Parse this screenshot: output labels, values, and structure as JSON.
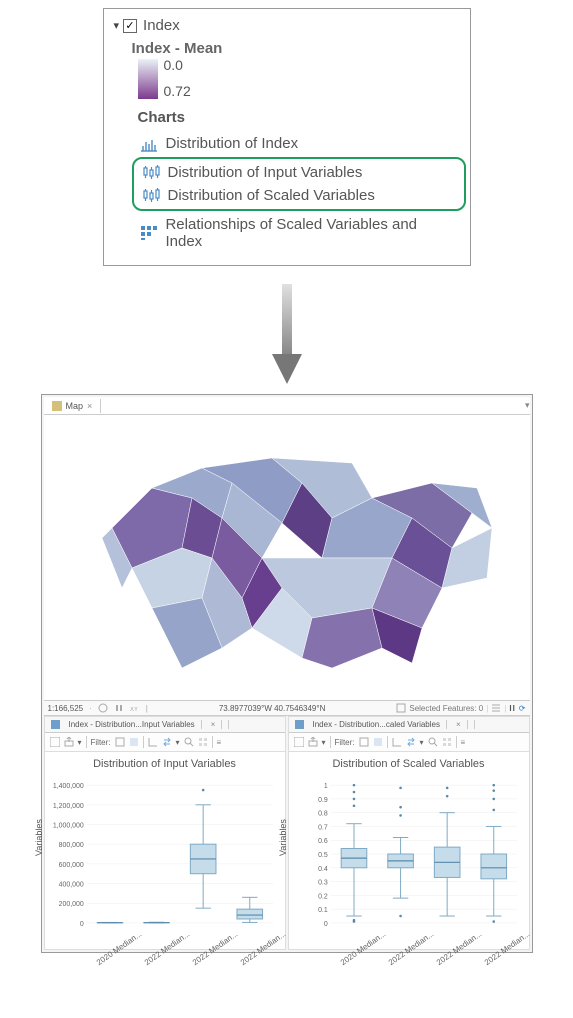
{
  "layer": {
    "name": "Index",
    "checked": true,
    "legend_title": "Index - Mean",
    "legend_min": "0.0",
    "legend_max": "0.72",
    "charts_header": "Charts",
    "chart_items": [
      {
        "label": "Distribution of Index",
        "icon": "histogram"
      },
      {
        "label": "Distribution of Input Variables",
        "icon": "boxplot"
      },
      {
        "label": "Distribution of Scaled Variables",
        "icon": "boxplot"
      },
      {
        "label": "Relationships of Scaled Variables and Index",
        "icon": "matrix"
      }
    ]
  },
  "map": {
    "tab_label": "Map",
    "scale": "1:166,525",
    "coords": "73.8977039°W 40.7546349°N",
    "selected_label": "Selected Features: 0",
    "colors": {
      "low": "#d6e4ef",
      "mid": "#8fa3c9",
      "high": "#762a83"
    }
  },
  "filter_label": "Filter:",
  "charts": {
    "left": {
      "tab": "Index - Distribution...Input Variables",
      "title": "Distribution of Input Variables",
      "y_label": "Variables"
    },
    "right": {
      "tab": "Index - Distribution...caled Variables",
      "title": "Distribution of Scaled Variables",
      "y_label": "Variables"
    }
  },
  "chart_data": [
    {
      "type": "boxplot",
      "title": "Distribution of Input Variables",
      "ylabel": "Variables",
      "ylim": [
        0,
        1400000
      ],
      "yticks": [
        0,
        200000,
        400000,
        600000,
        800000,
        1000000,
        1200000,
        1400000
      ],
      "ytick_labels": [
        "0",
        "200,000",
        "400,000",
        "600,000",
        "800,000",
        "1,000,000",
        "1,200,000",
        "1,400,000"
      ],
      "categories": [
        "2020 Median...",
        "2022 Median...",
        "2022 Median...",
        "2022 Median..."
      ],
      "series": [
        {
          "min": 0,
          "q1": 1000,
          "median": 2000,
          "q3": 3000,
          "max": 5000,
          "outliers": []
        },
        {
          "min": 0,
          "q1": 1500,
          "median": 2500,
          "q3": 4000,
          "max": 7000,
          "outliers": []
        },
        {
          "min": 150000,
          "q1": 500000,
          "median": 650000,
          "q3": 800000,
          "max": 1200000,
          "outliers": [
            1350000
          ]
        },
        {
          "min": 5000,
          "q1": 40000,
          "median": 80000,
          "q3": 140000,
          "max": 260000,
          "outliers": []
        }
      ]
    },
    {
      "type": "boxplot",
      "title": "Distribution of Scaled Variables",
      "ylabel": "Variables",
      "ylim": [
        0,
        1
      ],
      "yticks": [
        0,
        0.1,
        0.2,
        0.3,
        0.4,
        0.5,
        0.6,
        0.7,
        0.8,
        0.9,
        1
      ],
      "ytick_labels": [
        "0",
        "0.1",
        "0.2",
        "0.3",
        "0.4",
        "0.5",
        "0.6",
        "0.7",
        "0.8",
        "0.9",
        "1"
      ],
      "categories": [
        "2020 Median...",
        "2022 Median...",
        "2022 Median...",
        "2022 Median..."
      ],
      "series": [
        {
          "min": 0.05,
          "q1": 0.4,
          "median": 0.47,
          "q3": 0.54,
          "max": 0.72,
          "outliers": [
            0.85,
            0.9,
            0.95,
            1.0,
            0.02,
            0.01
          ]
        },
        {
          "min": 0.18,
          "q1": 0.4,
          "median": 0.45,
          "q3": 0.5,
          "max": 0.62,
          "outliers": [
            0.78,
            0.84,
            0.98,
            0.05
          ]
        },
        {
          "min": 0.05,
          "q1": 0.33,
          "median": 0.44,
          "q3": 0.55,
          "max": 0.8,
          "outliers": [
            0.92,
            0.98
          ]
        },
        {
          "min": 0.05,
          "q1": 0.32,
          "median": 0.4,
          "q3": 0.5,
          "max": 0.7,
          "outliers": [
            0.82,
            0.9,
            0.96,
            1.0,
            0.01
          ]
        }
      ]
    }
  ]
}
